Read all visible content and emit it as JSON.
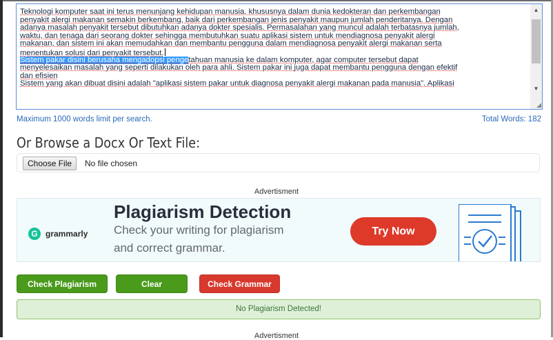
{
  "editor": {
    "lines": [
      "Teknologi komputer saat ini terus menunjang kehidupan manusia, khususnya dalam dunia kedokteran dan perkembangan",
      "penyakit alergi makanan semakin berkembang, baik dari perkembangan jenis penyakit maupun jumlah penderitanya. Dengan",
      "adanya masalah penyakit tersebut dibutuhkan adanya dokter spesialis. Permasalahan yang muncul adalah terbatasnya jumlah,",
      "waktu, dan tenaga dari seorang dokter sehingga membutuhkan suatu aplikasi sistem untuk mendiagnosa penyakit alergi",
      "makanan, dan sistem ini akan memudahkan dan membantu pengguna dalam mendiagnosa penyakit alergi makanan serta",
      "menentukan solusi dari penyakit tersebut."
    ],
    "selected_part": "Sistem pakar disini berusaha mengadopsi penge",
    "line7_rest": "tahuan manusia ke dalam komputer, agar computer tersebut dapat",
    "lines_after": [
      "menyelesaikan masalah yang seperti dilakukan oleh para ahli. Sistem pakar ini juga dapat membantu pengguna dengan efektif",
      "dan efisien",
      "Sistem yang akan dibuat disini adalah \"aplikasi sistem pakar untuk diagnosa penyakit alergi makanan pada manusia\". Aplikasi"
    ]
  },
  "word_limit_note": "Maximum 1000 words limit per search.",
  "total_words": "Total Words: 182",
  "browse_heading": "Or Browse a Docx Or Text File:",
  "file_input": {
    "button_label": "Choose File",
    "status": "No file chosen"
  },
  "ad": {
    "label": "Advertisment",
    "brand": "grammarly",
    "brand_glyph": "G",
    "title": "Plagiarism Detection",
    "subtitle_line1": "Check your writing for plagiarism",
    "subtitle_line2": "and correct grammar.",
    "cta": "Try Now",
    "colors": {
      "cta": "#dd3a2a",
      "brand": "#15c39a",
      "icon": "#2a7ad2"
    }
  },
  "actions": {
    "check_plagiarism": "Check Plagiarism",
    "clear": "Clear",
    "check_grammar": "Check Grammar"
  },
  "result": {
    "message": "No Plagiarism Detected!"
  },
  "ad_bottom_label": "Advertisment",
  "icons": {
    "scroll_up": "▲",
    "scroll_down": "▼",
    "resize": "◢"
  },
  "colors": {
    "green_button": "#4a9a1c",
    "red_button": "#d7392e",
    "result_bg": "#dff0d8",
    "link_blue": "#2a6ab8"
  }
}
